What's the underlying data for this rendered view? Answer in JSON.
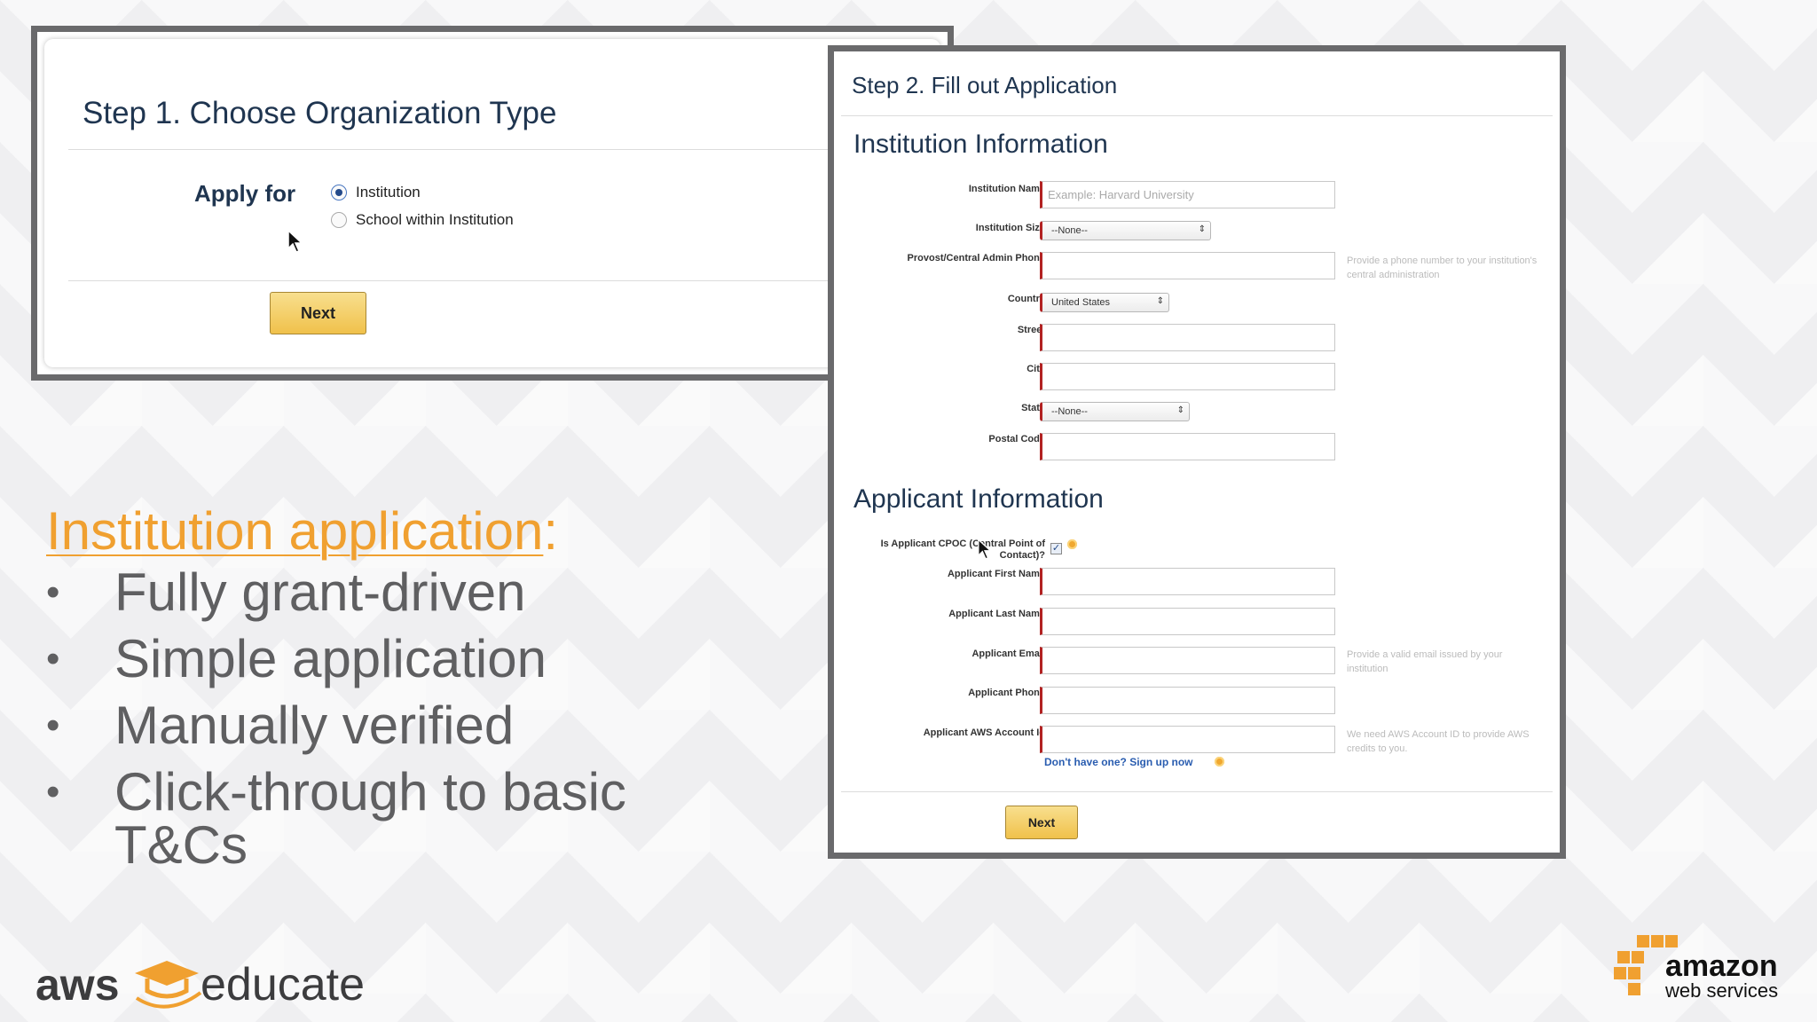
{
  "step1": {
    "title": "Step 1. Choose Organization Type",
    "apply_label": "Apply for",
    "options": [
      "Institution",
      "School within Institution"
    ],
    "selected_option": "Institution",
    "next_label": "Next"
  },
  "step2": {
    "title": "Step 2. Fill out Application",
    "institution_section": "Institution Information",
    "institution_name_label": "Institution Name",
    "institution_name_placeholder": "Example: Harvard University",
    "institution_size_label": "Institution Size",
    "institution_size_value": "--None--",
    "provost_phone_label": "Provost/Central Admin Phone",
    "provost_phone_hint": "Provide a phone number to your institution's central administration",
    "country_label": "Country",
    "country_value": "United States",
    "street_label": "Street",
    "city_label": "City",
    "state_label": "State",
    "state_value": "--None--",
    "postal_label": "Postal Code",
    "applicant_section": "Applicant Information",
    "cpoc_label": "Is Applicant CPOC (Central Point of Contact)?",
    "first_name_label": "Applicant First Name",
    "last_name_label": "Applicant Last Name",
    "email_label": "Applicant Email",
    "email_hint": "Provide a valid email issued by your institution",
    "phone_label": "Applicant Phone",
    "aws_id_label": "Applicant AWS Account Id",
    "aws_id_hint": "We need AWS Account ID to provide AWS credits to you.",
    "signup_link": "Don't have one? Sign up now",
    "next_label": "Next"
  },
  "slide": {
    "headline": "Institution application",
    "headline_colon": ":",
    "bullets": [
      "Fully grant-driven",
      "Simple application",
      "Manually verified",
      "Click-through to basic T&Cs"
    ]
  },
  "branding": {
    "aws_word": "aws",
    "educate_word": "educate",
    "amazon_word": "amazon",
    "webservices_word": "web services"
  },
  "colors": {
    "accent_orange": "#f0a030",
    "navy_text": "#1f3550",
    "button_gold": "#f0c14b",
    "required_red": "#b22222"
  }
}
